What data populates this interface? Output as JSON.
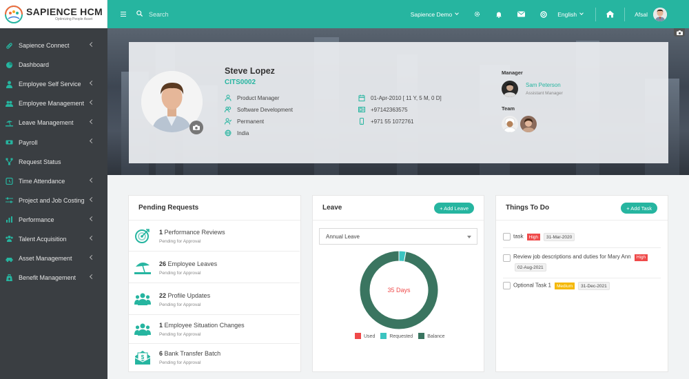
{
  "colors": {
    "accent": "#26b5a0",
    "sidebar": "#3a3e42",
    "high": "#ef4a4a",
    "medium": "#f5b800",
    "used": "#ef4a4a",
    "requested": "#3bc4c0",
    "balance": "#3a7560"
  },
  "brand": {
    "title": "SAPIENCE HCM",
    "tagline": "Optimizing People Asset"
  },
  "sidebar": {
    "items": [
      {
        "label": "Sapience Connect",
        "icon": "link-icon"
      },
      {
        "label": "Dashboard",
        "icon": "pie-icon"
      },
      {
        "label": "Employee Self Service",
        "icon": "user-icon"
      },
      {
        "label": "Employee Management",
        "icon": "users-icon"
      },
      {
        "label": "Leave Management",
        "icon": "beach-icon"
      },
      {
        "label": "Payroll",
        "icon": "money-icon"
      },
      {
        "label": "Request Status",
        "icon": "sitemap-icon"
      },
      {
        "label": "Time Attendance",
        "icon": "clock-icon"
      },
      {
        "label": "Project and Job Costing",
        "icon": "sliders-icon"
      },
      {
        "label": "Performance",
        "icon": "chart-icon"
      },
      {
        "label": "Talent Acquisition",
        "icon": "group-icon"
      },
      {
        "label": "Asset Management",
        "icon": "car-icon"
      },
      {
        "label": "Benefit Management",
        "icon": "medkit-icon"
      }
    ]
  },
  "topbar": {
    "search_placeholder": "Search",
    "company": "Sapience Demo",
    "language": "English",
    "user": "Afsal"
  },
  "profile": {
    "name": "Steve Lopez",
    "code": "CITS0002",
    "designation": "Product Manager",
    "department": "Software Development",
    "employment_type": "Permanent",
    "country": "India",
    "join_date": "01-Apr-2010 [ 11 Y, 5 M, 0 D]",
    "phone": "+97142363575",
    "mobile": "+971 55 1072761",
    "manager_label": "Manager",
    "manager_name": "Sam Peterson",
    "manager_role": "Assistant Manager",
    "team_label": "Team"
  },
  "pending": {
    "title": "Pending Requests",
    "items": [
      {
        "count": "1",
        "label": "Performance Reviews",
        "status": "Pending for Approval",
        "icon": "target-icon"
      },
      {
        "count": "26",
        "label": "Employee Leaves",
        "status": "Pending for Approval",
        "icon": "umbrella-icon"
      },
      {
        "count": "22",
        "label": "Profile Updates",
        "status": "Pending for Approval",
        "icon": "users-icon"
      },
      {
        "count": "1",
        "label": "Employee Situation Changes",
        "status": "Pending for Approval",
        "icon": "users-icon"
      },
      {
        "count": "6",
        "label": "Bank Transfer Batch",
        "status": "Pending for Approval",
        "icon": "envelope-money-icon"
      }
    ]
  },
  "leave": {
    "title": "Leave",
    "add_label": "+ Add Leave",
    "selected_type": "Annual Leave",
    "center_label": "35 Days",
    "legend": [
      "Used",
      "Requested",
      "Balance"
    ]
  },
  "chart_data": {
    "type": "pie",
    "categories": [
      "Used",
      "Requested",
      "Balance"
    ],
    "values": [
      0,
      1,
      34
    ],
    "title": "35 Days"
  },
  "todo": {
    "title": "Things To Do",
    "add_label": "+ Add Task",
    "items": [
      {
        "text": "task",
        "priority": "High",
        "date": "31-Mar-2020"
      },
      {
        "text": "Review job descriptions and duties for Mary Ann",
        "priority": "High",
        "date": "02-Aug-2021"
      },
      {
        "text": "Optional Task 1",
        "priority": "Medium",
        "date": "31-Dec-2021"
      }
    ]
  }
}
